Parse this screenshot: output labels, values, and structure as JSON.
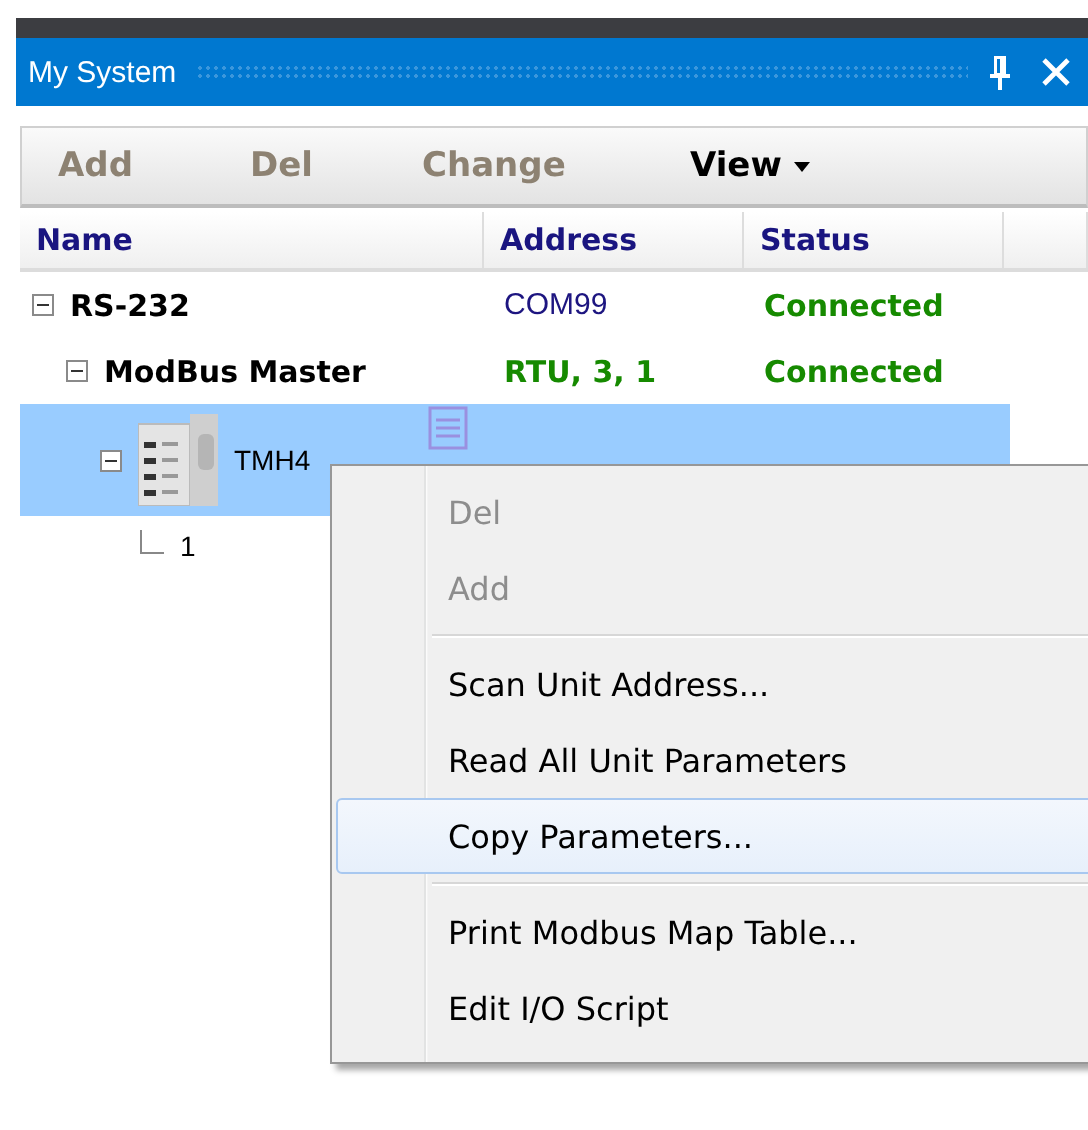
{
  "panel": {
    "title": "My System"
  },
  "toolbar": [
    {
      "label": "Add",
      "disabled": true
    },
    {
      "label": "Del",
      "disabled": true
    },
    {
      "label": "Change",
      "disabled": true
    },
    {
      "label": "View",
      "disabled": false,
      "dropdown": true
    }
  ],
  "table": {
    "columns": [
      "Name",
      "Address",
      "Status"
    ],
    "rows": [
      {
        "kind": "port",
        "name": "RS-232",
        "address": "COM99",
        "status": "Connected",
        "expanded": true,
        "selected": false,
        "children": [
          {
            "kind": "master",
            "name": "ModBus Master",
            "address": "RTU, 3, 1",
            "status": "Connected",
            "expanded": true,
            "selected": false,
            "children": [
              {
                "kind": "device",
                "name": "TMH4",
                "expanded": true,
                "selected": true,
                "children": [
                  {
                    "kind": "unit",
                    "name": "1",
                    "selected": false
                  }
                ]
              }
            ]
          }
        ]
      }
    ]
  },
  "context_menu": {
    "items": [
      {
        "kind": "item",
        "label": "Del",
        "disabled": true,
        "selected": false
      },
      {
        "kind": "item",
        "label": "Add",
        "disabled": true,
        "selected": false
      },
      {
        "kind": "separator"
      },
      {
        "kind": "item",
        "label": "Scan Unit Address...",
        "disabled": false,
        "selected": false
      },
      {
        "kind": "item",
        "label": "Read All Unit Parameters",
        "disabled": false,
        "selected": false
      },
      {
        "kind": "item",
        "label": "Copy Parameters...",
        "disabled": false,
        "selected": true
      },
      {
        "kind": "separator"
      },
      {
        "kind": "item",
        "label": "Print Modbus Map Table...",
        "disabled": false,
        "selected": false
      },
      {
        "kind": "item",
        "label": "Edit I/O Script",
        "disabled": false,
        "selected": false
      }
    ]
  }
}
